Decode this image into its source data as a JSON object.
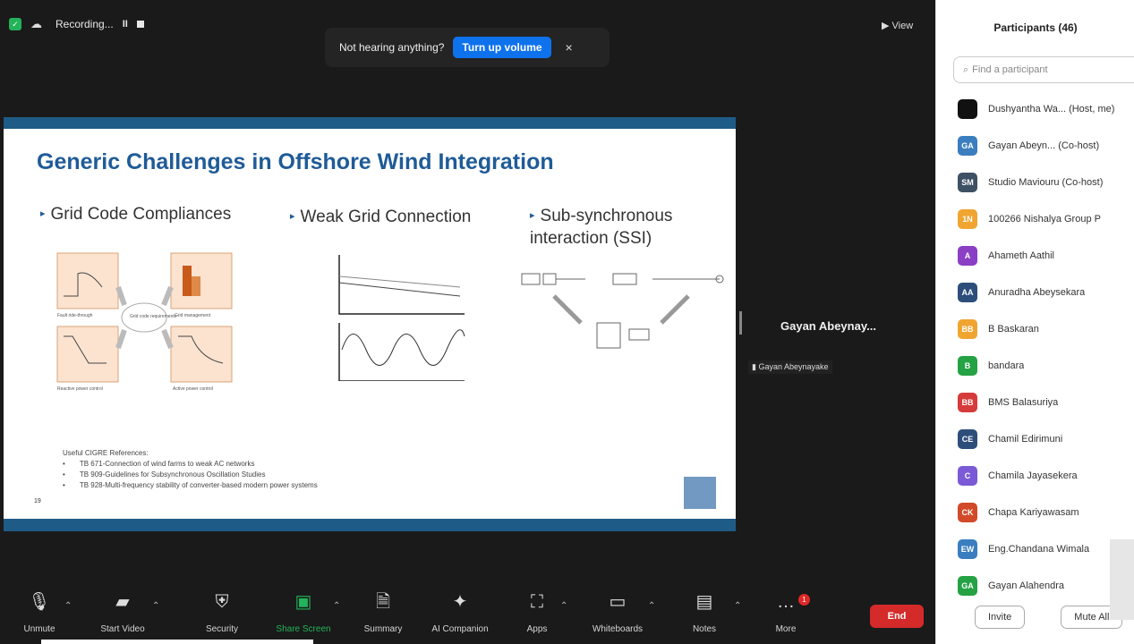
{
  "topbar": {
    "recording_label": "Recording...",
    "pause_glyph": "II",
    "view_label": "View"
  },
  "toast": {
    "message": "Not hearing anything?",
    "action_label": "Turn up volume",
    "close_glyph": "×"
  },
  "slide": {
    "title": "Generic Challenges in Offshore Wind Integration",
    "columns": [
      "Grid Code Compliances",
      "Weak Grid Connection",
      "Sub-synchronous interaction (SSI)"
    ],
    "grid_code_labels": [
      "Fault ride-through",
      "Grid code requirements",
      "Grid management",
      "Reactive power control",
      "Active power control"
    ],
    "refs_title": "Useful CIGRE References:",
    "refs": [
      "TB 671-Connection of wind farms to weak AC networks",
      "TB 909-Guidelines for Subsynchronous Oscillation Studies",
      "TB 928-Multi-frequency stability of converter-based modern power systems"
    ],
    "page_number": "19"
  },
  "speaker": {
    "name": "Gayan Abeynay...",
    "tag": "Gayan Abeynayake"
  },
  "toolbar": {
    "items": [
      {
        "label": "Unmute",
        "icon": "mic-muted-icon"
      },
      {
        "label": "Start Video",
        "icon": "video-off-icon"
      },
      {
        "label": "Security",
        "icon": "shield-icon"
      },
      {
        "label": "Share Screen",
        "icon": "share-screen-icon"
      },
      {
        "label": "Summary",
        "icon": "summary-icon"
      },
      {
        "label": "AI Companion",
        "icon": "sparkle-icon"
      },
      {
        "label": "Apps",
        "icon": "apps-icon"
      },
      {
        "label": "Whiteboards",
        "icon": "whiteboard-icon"
      },
      {
        "label": "Notes",
        "icon": "notes-icon"
      },
      {
        "label": "More",
        "icon": "more-icon"
      }
    ],
    "more_badge": "1",
    "end_label": "End"
  },
  "participants": {
    "title": "Participants (46)",
    "search_placeholder": "Find a participant",
    "list": [
      {
        "initials": "",
        "name": "Dushyantha Wa... (Host, me)",
        "color": "#111111"
      },
      {
        "initials": "GA",
        "name": "Gayan Abeyn... (Co-host)",
        "color": "#3a7ebf"
      },
      {
        "initials": "SM",
        "name": "Studio Maviouru (Co-host)",
        "color": "#3e5064"
      },
      {
        "initials": "1N",
        "name": "100266 Nishalya Group P",
        "color": "#f0a531"
      },
      {
        "initials": "A",
        "name": "Ahameth Aathil",
        "color": "#8a3fc5"
      },
      {
        "initials": "AA",
        "name": "Anuradha Abeysekara",
        "color": "#2d4e7a"
      },
      {
        "initials": "BB",
        "name": "B Baskaran",
        "color": "#f0a531"
      },
      {
        "initials": "B",
        "name": "bandara",
        "color": "#25a244"
      },
      {
        "initials": "BB",
        "name": "BMS Balasuriya",
        "color": "#d63b3b"
      },
      {
        "initials": "CE",
        "name": "Chamil Edirimuni",
        "color": "#2d4e7a"
      },
      {
        "initials": "C",
        "name": "Chamila Jayasekera",
        "color": "#7a5ad6"
      },
      {
        "initials": "CK",
        "name": "Chapa Kariyawasam",
        "color": "#d24a2a"
      },
      {
        "initials": "EW",
        "name": "Eng.Chandana Wimala",
        "color": "#3a7ebf"
      },
      {
        "initials": "GA",
        "name": "Gayan Alahendra",
        "color": "#25a244"
      }
    ],
    "invite_label": "Invite",
    "mute_label": "Mute All"
  },
  "colors": {
    "brand_blue": "#0e72ed",
    "slide_blue": "#1f5b87",
    "end_red": "#d42a2a",
    "share_green": "#23b35a"
  }
}
